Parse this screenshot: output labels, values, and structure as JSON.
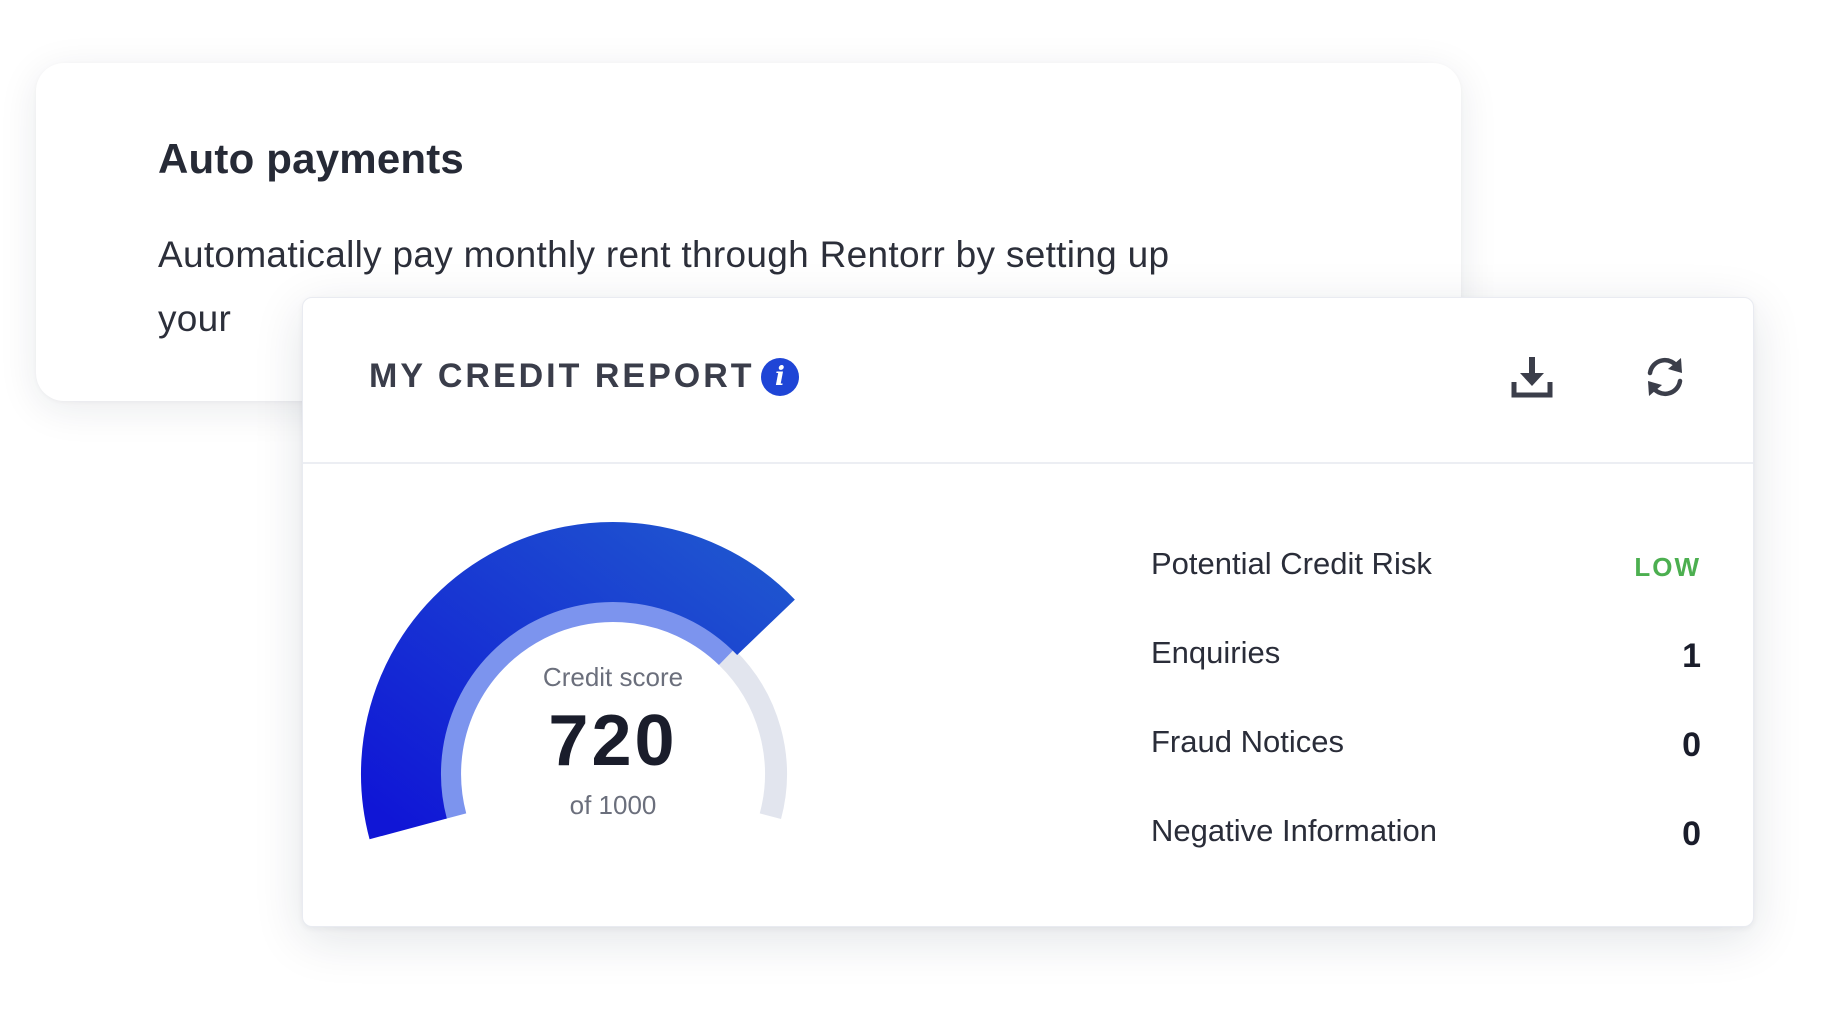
{
  "auto_payments": {
    "title": "Auto payments",
    "description": "Automatically pay monthly rent through Rentorr by setting up your"
  },
  "credit_report": {
    "title": "MY CREDIT REPORT",
    "info_icon": "i",
    "actions": [
      {
        "icon": "download-icon"
      },
      {
        "icon": "refresh-icon"
      }
    ],
    "score": {
      "caption": "Credit score",
      "value": "720",
      "max_label": "of 1000",
      "score_number": 720,
      "max_number": 1000
    },
    "stats": [
      {
        "label": "Potential Credit Risk",
        "value": "LOW"
      },
      {
        "label": "Enquiries",
        "value": "1"
      },
      {
        "label": "Fraud Notices",
        "value": "0"
      },
      {
        "label": "Negative Information",
        "value": "0"
      }
    ]
  },
  "colors": {
    "accent": "#1f45d6",
    "gauge_dark": "#1a1fd9",
    "gauge_light": "#7c94ee",
    "gauge_track": "#e2e5ee",
    "risk_low": "#4caf50"
  }
}
